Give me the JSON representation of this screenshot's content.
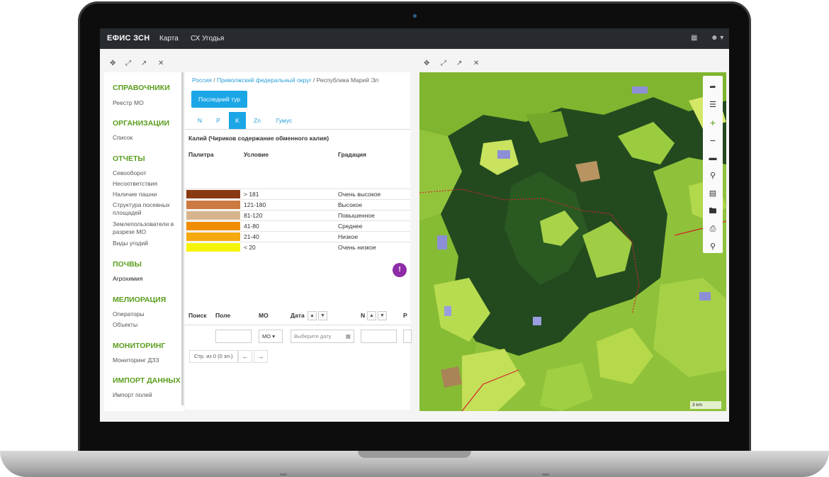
{
  "navbar": {
    "brand": "ЕФИС ЗСН",
    "links": [
      "Карта",
      "СХ Угодья"
    ],
    "icons": [
      "apps-grid-icon",
      "user-icon"
    ]
  },
  "sidebar": {
    "sections": [
      {
        "title": "СПРАВОЧНИКИ",
        "items": [
          "Реестр МО"
        ]
      },
      {
        "title": "ОРГАНИЗАЦИИ",
        "items": [
          "Список"
        ]
      },
      {
        "title": "ОТЧЕТЫ",
        "items": [
          "Севооборот",
          "Несоответствия",
          "Наличие пашни",
          "Структура посевных площадей",
          "Землепользователи в разрезе МО",
          "Виды угодий"
        ]
      },
      {
        "title": "ПОЧВЫ",
        "items": [
          "Агрохимия"
        ]
      },
      {
        "title": "МЕЛИОРАЦИЯ",
        "items": [
          "Операторы",
          "Объекты"
        ]
      },
      {
        "title": "МОНИТОРИНГ",
        "items": [
          "Мониторинг ДЗЗ"
        ]
      },
      {
        "title": "ИМПОРТ ДАННЫХ",
        "items": [
          "Импорт полей"
        ]
      }
    ]
  },
  "breadcrumb": {
    "items": [
      "Россия",
      "Приволжский федеральный округ",
      "Республика Марий Эл"
    ],
    "separator": "/"
  },
  "content": {
    "primary_button": "Последний тур",
    "tabs": [
      "N",
      "P",
      "K",
      "Zn",
      "Гумус"
    ],
    "active_tab": "K",
    "legend_title": "Калий (Чириков содержание обменного калия)",
    "legend_headers": [
      "Палитра",
      "Условие",
      "Градация"
    ],
    "legend_rows": [
      {
        "color": "#8a3a12",
        "condition": "> 181",
        "grade": "Очень высокое"
      },
      {
        "color": "#cd7a42",
        "condition": "121-180",
        "grade": "Высокое"
      },
      {
        "color": "#d7b58c",
        "condition": "81-120",
        "grade": "Повышенное"
      },
      {
        "color": "#f08c00",
        "condition": "41-80",
        "grade": "Среднее"
      },
      {
        "color": "#f6a80f",
        "condition": "21-40",
        "grade": "Низкое"
      },
      {
        "color": "#f6f40a",
        "condition": "< 20",
        "grade": "Очень низкое"
      }
    ],
    "info_icon": "info-icon"
  },
  "table": {
    "headers": [
      "Поиск",
      "Поле",
      "МО",
      "Дата",
      "N",
      "P"
    ],
    "mo_select": "МО",
    "date_placeholder": "Выберите дату",
    "pager_info": "Стр. из 0 (0 эл.)",
    "prev": "←",
    "next": "→"
  },
  "map": {
    "scale_label": "3 km",
    "tools": [
      "select-arrow-icon",
      "layers-icon",
      "zoom-in-icon",
      "zoom-out-icon",
      "ruler-icon",
      "pin-icon",
      "tape-icon",
      "folder-icon",
      "print-icon",
      "search-icon"
    ],
    "colors": {
      "forest": "#1f3a1c",
      "field": "#8fc23a",
      "field_light": "#b5d94a",
      "water": "#8c8fd6",
      "border": "#d1242a"
    }
  }
}
